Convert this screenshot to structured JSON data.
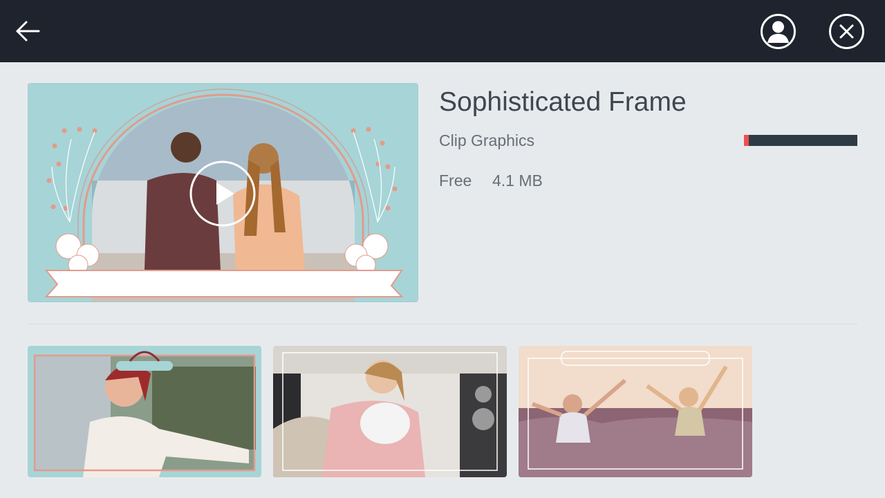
{
  "topbar": {
    "back_icon": "arrow-left-icon",
    "profile_icon": "user-circle-icon",
    "close_icon": "close-circle-icon"
  },
  "item": {
    "title": "Sophisticated Frame",
    "category": "Clip Graphics",
    "price": "Free",
    "size": "4.1 MB",
    "download_progress": 0.04
  },
  "preview": {
    "play_icon": "play-circle-icon"
  },
  "colors": {
    "topbar": "#1f232e",
    "background": "#e7eaed",
    "accent": "#ef4f4f",
    "progress_track": "#2e3b44",
    "frame_teal": "#a7d4d6",
    "frame_rose": "#e49a8c"
  }
}
